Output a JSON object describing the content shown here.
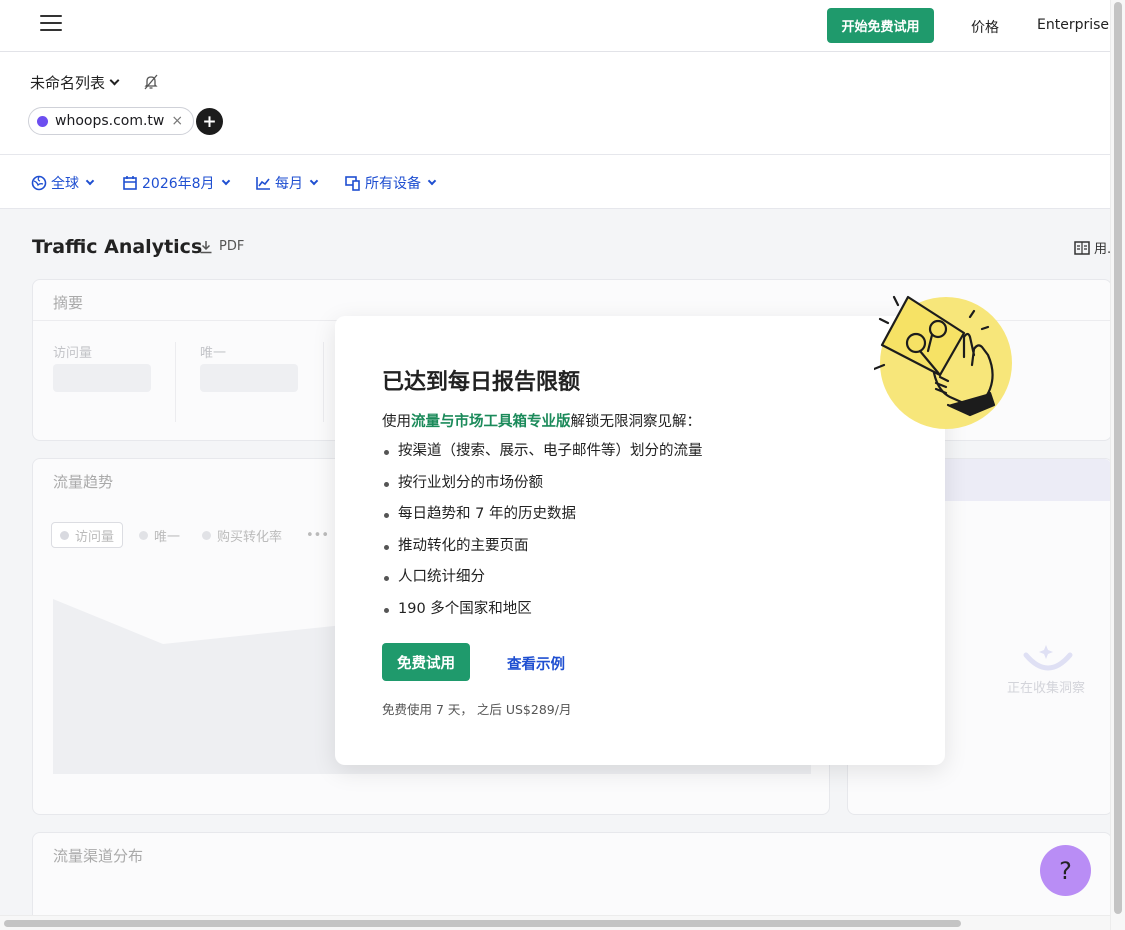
{
  "topbar": {
    "trial_button": "开始免费试用",
    "nav_pricing": "价格",
    "nav_enterprise": "Enterprise"
  },
  "list": {
    "title": "未命名列表",
    "chip_domain": "whoops.com.tw",
    "chip_close": "×",
    "add_label": "+"
  },
  "filters": {
    "region": "全球",
    "date": "2026年8月",
    "granularity": "每月",
    "device": "所有设备"
  },
  "page": {
    "title": "Traffic Analytics",
    "pdf_label": "PDF",
    "book_label": "用."
  },
  "summary": {
    "title": "摘要",
    "metric_visits": "访问量",
    "metric_unique": "唯一"
  },
  "trend": {
    "title": "流量趋势",
    "tab_visits": "访问量",
    "tab_unique": "唯一",
    "tab_conversion": "购买转化率",
    "tab_more": "•••"
  },
  "insights": {
    "loading_text": "正在收集洞察"
  },
  "channels": {
    "title": "流量渠道分布"
  },
  "modal": {
    "heading": "已达到每日报告限额",
    "intro_prefix": "使用",
    "intro_highlight": "流量与市场工具箱专业版",
    "intro_suffix": "解锁无限洞察见解：",
    "bullets": [
      "按渠道（搜索、展示、电子邮件等）划分的流量",
      "按行业划分的市场份额",
      "每日趋势和 7 年的历史数据",
      "推动转化的主要页面",
      "人口统计细分",
      "190 多个国家和地区"
    ],
    "primary_button": "免费试用",
    "secondary_link": "查看示例",
    "price_note": "免费使用 7 天， 之后 US$289/月"
  },
  "help": {
    "label": "?"
  },
  "colors": {
    "brand_green": "#1f9a6c",
    "link_blue": "#1f4fd1",
    "highlight_green": "#1b8a5a",
    "help_purple": "#b98df5",
    "domain_dot": "#6c4ef0"
  }
}
